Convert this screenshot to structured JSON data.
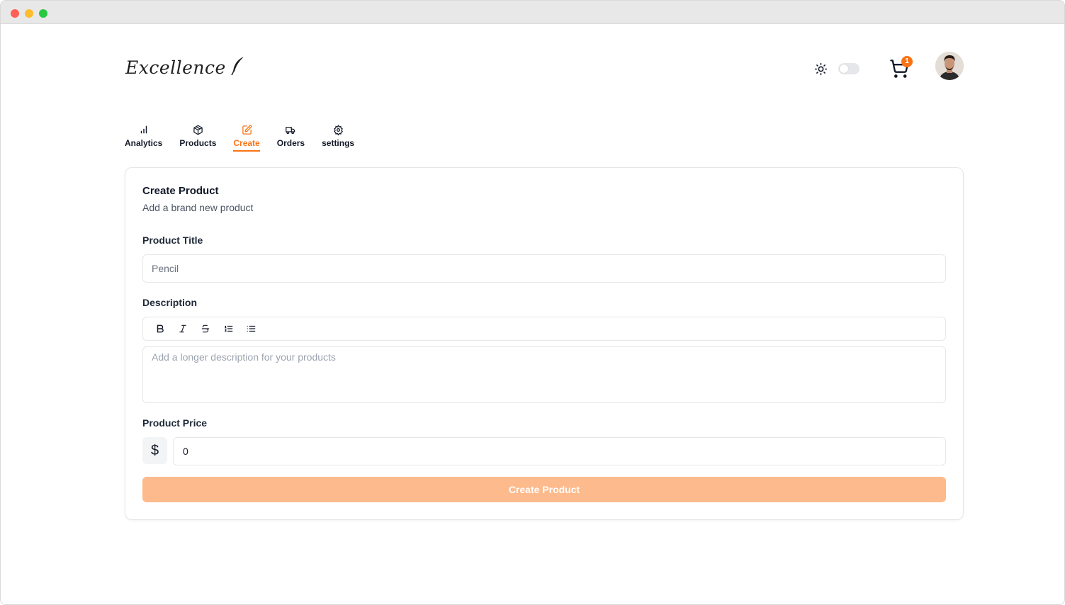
{
  "brand": {
    "name": "Excellence"
  },
  "header": {
    "theme_toggle": "off",
    "cart_count": "1"
  },
  "tabs": [
    {
      "label": "Analytics",
      "icon": "bar-chart-icon",
      "active": false
    },
    {
      "label": "Products",
      "icon": "package-icon",
      "active": false
    },
    {
      "label": "Create",
      "icon": "edit-icon",
      "active": true
    },
    {
      "label": "Orders",
      "icon": "truck-icon",
      "active": false
    },
    {
      "label": "settings",
      "icon": "gear-icon",
      "active": false
    }
  ],
  "form": {
    "title": "Create Product",
    "subtitle": "Add a brand new product",
    "title_label": "Product Title",
    "title_value": "Pencil",
    "description_label": "Description",
    "description_placeholder": "Add a longer description for your products",
    "toolbar": [
      "bold-icon",
      "italic-icon",
      "strikethrough-icon",
      "ordered-list-icon",
      "bullet-list-icon"
    ],
    "price_label": "Product Price",
    "currency_symbol": "$",
    "price_value": "0",
    "submit_label": "Create Product"
  },
  "colors": {
    "accent": "#f97316",
    "submit_disabled": "#fdba8c"
  }
}
